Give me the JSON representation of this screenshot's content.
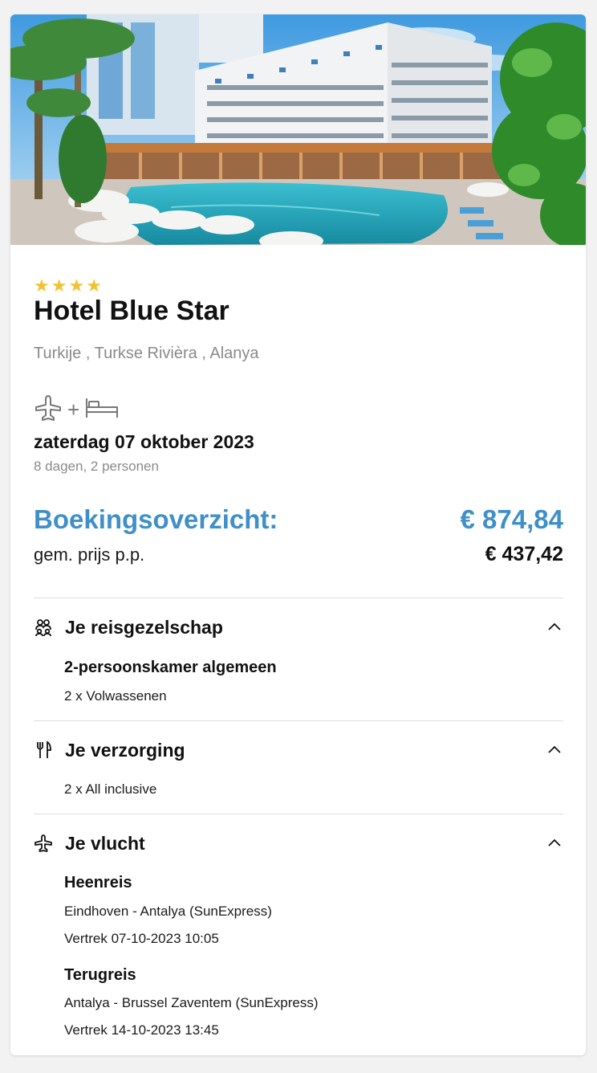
{
  "hotel": {
    "stars": [
      "★",
      "★",
      "★",
      "★"
    ],
    "name": "Hotel Blue Star",
    "location": [
      "Turkije",
      "Turkse Rivièra",
      "Alanya"
    ],
    "travel_type_icons": [
      "plane-icon",
      "bed-icon"
    ],
    "travel_type_plus": "+",
    "date": "zaterdag 07 oktober 2023",
    "duration": "8 dagen, 2 personen"
  },
  "booking": {
    "title": "Boekingsoverzicht:",
    "total_price": "€ 874,84",
    "pp_label": "gem. prijs p.p.",
    "pp_price": "€ 437,42"
  },
  "sections": {
    "party": {
      "icon": "group-icon",
      "title": "Je reisgezelschap",
      "room": "2-persoonskamer algemeen",
      "guests": "2 x Volwassenen"
    },
    "board": {
      "icon": "cutlery-icon",
      "title": "Je verzorging",
      "board_type": "2 x All inclusive"
    },
    "flight": {
      "icon": "plane-icon",
      "title": "Je vlucht",
      "outbound_label": "Heenreis",
      "outbound_route": "Eindhoven - Antalya (SunExpress)",
      "outbound_departure": "Vertrek 07-10-2023 10:05",
      "return_label": "Terugreis",
      "return_route": "Antalya - Brussel Zaventem (SunExpress)",
      "return_departure": "Vertrek 14-10-2023 13:45"
    }
  },
  "colors": {
    "accent": "#3f8fc9",
    "star": "#f2c230",
    "muted": "#8a8a8a"
  }
}
